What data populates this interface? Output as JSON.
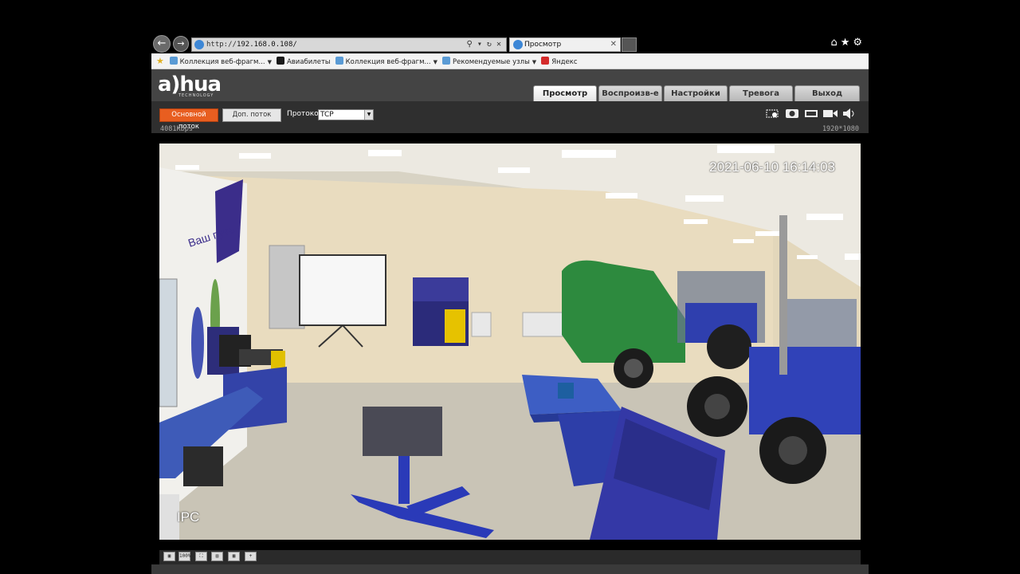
{
  "browser": {
    "url_prefix": "http://",
    "url_host": "192.168.0.108/",
    "tab_title": "Просмотр",
    "tab_close": "✕",
    "addr_tools": "⚲ ▾ ↻ ✕",
    "back_icon": "←",
    "forward_icon": "→",
    "right_icons": "⌂★⚙"
  },
  "favorites": [
    {
      "label": "Коллекция веб-фрагм...",
      "dropdown": true,
      "color": "#5a9bd5"
    },
    {
      "label": "Авиабилеты",
      "dropdown": false,
      "color": "#1a1a1a"
    },
    {
      "label": "Коллекция веб-фрагм...",
      "dropdown": true,
      "color": "#5a9bd5"
    },
    {
      "label": "Рекомендуемые узлы",
      "dropdown": true,
      "color": "#5a9bd5"
    },
    {
      "label": "Яндекс",
      "dropdown": false,
      "color": "#d42b2b"
    }
  ],
  "header": {
    "logo": "a)hua",
    "logo_sub": "TECHNOLOGY",
    "tabs": [
      "Просмотр",
      "Воспроизв-е",
      "Настройки",
      "Тревога",
      "Выход"
    ],
    "active_tab": "Просмотр"
  },
  "toolbar": {
    "main_stream": "Основной поток",
    "sub_stream": "Доп. поток",
    "protocol_label": "Протокол",
    "protocol_value": "TCP",
    "bitrate": "4081Kbps",
    "resolution": "1920*1080"
  },
  "video": {
    "osd_time": "2021-06-10 16:14:03",
    "osd_name": "IPC"
  },
  "bottom_controls": [
    "▣",
    "100%",
    "⛶",
    "▤",
    "▦",
    "+"
  ]
}
